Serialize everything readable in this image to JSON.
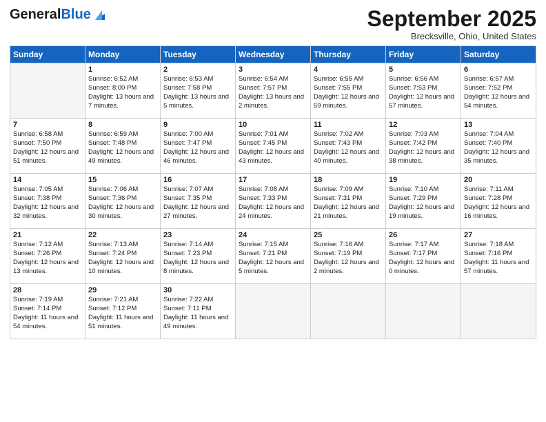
{
  "header": {
    "logo_general": "General",
    "logo_blue": "Blue",
    "month_title": "September 2025",
    "location": "Brecksville, Ohio, United States"
  },
  "days_of_week": [
    "Sunday",
    "Monday",
    "Tuesday",
    "Wednesday",
    "Thursday",
    "Friday",
    "Saturday"
  ],
  "weeks": [
    [
      {
        "num": "",
        "sunrise": "",
        "sunset": "",
        "daylight": ""
      },
      {
        "num": "1",
        "sunrise": "Sunrise: 6:52 AM",
        "sunset": "Sunset: 8:00 PM",
        "daylight": "Daylight: 13 hours and 7 minutes."
      },
      {
        "num": "2",
        "sunrise": "Sunrise: 6:53 AM",
        "sunset": "Sunset: 7:58 PM",
        "daylight": "Daylight: 13 hours and 5 minutes."
      },
      {
        "num": "3",
        "sunrise": "Sunrise: 6:54 AM",
        "sunset": "Sunset: 7:57 PM",
        "daylight": "Daylight: 13 hours and 2 minutes."
      },
      {
        "num": "4",
        "sunrise": "Sunrise: 6:55 AM",
        "sunset": "Sunset: 7:55 PM",
        "daylight": "Daylight: 12 hours and 59 minutes."
      },
      {
        "num": "5",
        "sunrise": "Sunrise: 6:56 AM",
        "sunset": "Sunset: 7:53 PM",
        "daylight": "Daylight: 12 hours and 57 minutes."
      },
      {
        "num": "6",
        "sunrise": "Sunrise: 6:57 AM",
        "sunset": "Sunset: 7:52 PM",
        "daylight": "Daylight: 12 hours and 54 minutes."
      }
    ],
    [
      {
        "num": "7",
        "sunrise": "Sunrise: 6:58 AM",
        "sunset": "Sunset: 7:50 PM",
        "daylight": "Daylight: 12 hours and 51 minutes."
      },
      {
        "num": "8",
        "sunrise": "Sunrise: 6:59 AM",
        "sunset": "Sunset: 7:48 PM",
        "daylight": "Daylight: 12 hours and 49 minutes."
      },
      {
        "num": "9",
        "sunrise": "Sunrise: 7:00 AM",
        "sunset": "Sunset: 7:47 PM",
        "daylight": "Daylight: 12 hours and 46 minutes."
      },
      {
        "num": "10",
        "sunrise": "Sunrise: 7:01 AM",
        "sunset": "Sunset: 7:45 PM",
        "daylight": "Daylight: 12 hours and 43 minutes."
      },
      {
        "num": "11",
        "sunrise": "Sunrise: 7:02 AM",
        "sunset": "Sunset: 7:43 PM",
        "daylight": "Daylight: 12 hours and 40 minutes."
      },
      {
        "num": "12",
        "sunrise": "Sunrise: 7:03 AM",
        "sunset": "Sunset: 7:42 PM",
        "daylight": "Daylight: 12 hours and 38 minutes."
      },
      {
        "num": "13",
        "sunrise": "Sunrise: 7:04 AM",
        "sunset": "Sunset: 7:40 PM",
        "daylight": "Daylight: 12 hours and 35 minutes."
      }
    ],
    [
      {
        "num": "14",
        "sunrise": "Sunrise: 7:05 AM",
        "sunset": "Sunset: 7:38 PM",
        "daylight": "Daylight: 12 hours and 32 minutes."
      },
      {
        "num": "15",
        "sunrise": "Sunrise: 7:06 AM",
        "sunset": "Sunset: 7:36 PM",
        "daylight": "Daylight: 12 hours and 30 minutes."
      },
      {
        "num": "16",
        "sunrise": "Sunrise: 7:07 AM",
        "sunset": "Sunset: 7:35 PM",
        "daylight": "Daylight: 12 hours and 27 minutes."
      },
      {
        "num": "17",
        "sunrise": "Sunrise: 7:08 AM",
        "sunset": "Sunset: 7:33 PM",
        "daylight": "Daylight: 12 hours and 24 minutes."
      },
      {
        "num": "18",
        "sunrise": "Sunrise: 7:09 AM",
        "sunset": "Sunset: 7:31 PM",
        "daylight": "Daylight: 12 hours and 21 minutes."
      },
      {
        "num": "19",
        "sunrise": "Sunrise: 7:10 AM",
        "sunset": "Sunset: 7:29 PM",
        "daylight": "Daylight: 12 hours and 19 minutes."
      },
      {
        "num": "20",
        "sunrise": "Sunrise: 7:11 AM",
        "sunset": "Sunset: 7:28 PM",
        "daylight": "Daylight: 12 hours and 16 minutes."
      }
    ],
    [
      {
        "num": "21",
        "sunrise": "Sunrise: 7:12 AM",
        "sunset": "Sunset: 7:26 PM",
        "daylight": "Daylight: 12 hours and 13 minutes."
      },
      {
        "num": "22",
        "sunrise": "Sunrise: 7:13 AM",
        "sunset": "Sunset: 7:24 PM",
        "daylight": "Daylight: 12 hours and 10 minutes."
      },
      {
        "num": "23",
        "sunrise": "Sunrise: 7:14 AM",
        "sunset": "Sunset: 7:23 PM",
        "daylight": "Daylight: 12 hours and 8 minutes."
      },
      {
        "num": "24",
        "sunrise": "Sunrise: 7:15 AM",
        "sunset": "Sunset: 7:21 PM",
        "daylight": "Daylight: 12 hours and 5 minutes."
      },
      {
        "num": "25",
        "sunrise": "Sunrise: 7:16 AM",
        "sunset": "Sunset: 7:19 PM",
        "daylight": "Daylight: 12 hours and 2 minutes."
      },
      {
        "num": "26",
        "sunrise": "Sunrise: 7:17 AM",
        "sunset": "Sunset: 7:17 PM",
        "daylight": "Daylight: 12 hours and 0 minutes."
      },
      {
        "num": "27",
        "sunrise": "Sunrise: 7:18 AM",
        "sunset": "Sunset: 7:16 PM",
        "daylight": "Daylight: 11 hours and 57 minutes."
      }
    ],
    [
      {
        "num": "28",
        "sunrise": "Sunrise: 7:19 AM",
        "sunset": "Sunset: 7:14 PM",
        "daylight": "Daylight: 11 hours and 54 minutes."
      },
      {
        "num": "29",
        "sunrise": "Sunrise: 7:21 AM",
        "sunset": "Sunset: 7:12 PM",
        "daylight": "Daylight: 11 hours and 51 minutes."
      },
      {
        "num": "30",
        "sunrise": "Sunrise: 7:22 AM",
        "sunset": "Sunset: 7:11 PM",
        "daylight": "Daylight: 11 hours and 49 minutes."
      },
      {
        "num": "",
        "sunrise": "",
        "sunset": "",
        "daylight": ""
      },
      {
        "num": "",
        "sunrise": "",
        "sunset": "",
        "daylight": ""
      },
      {
        "num": "",
        "sunrise": "",
        "sunset": "",
        "daylight": ""
      },
      {
        "num": "",
        "sunrise": "",
        "sunset": "",
        "daylight": ""
      }
    ]
  ]
}
